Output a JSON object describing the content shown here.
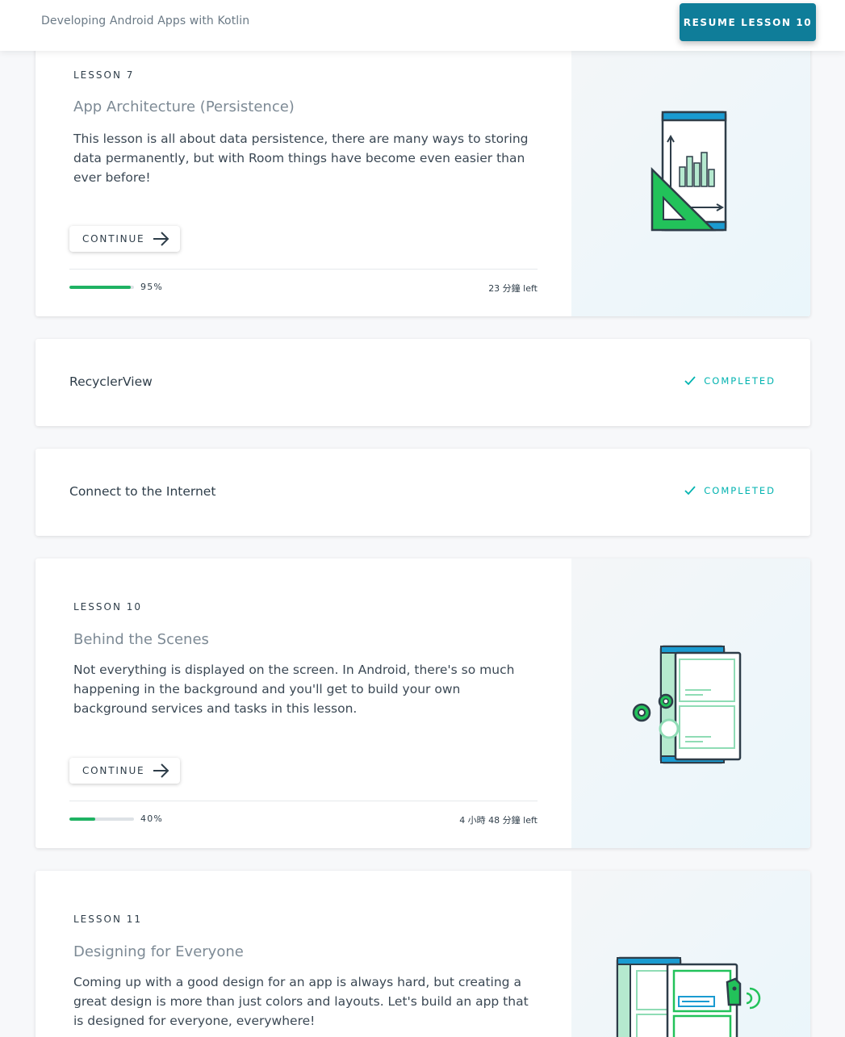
{
  "header": {
    "course_title": "Developing Android Apps with Kotlin",
    "resume_label": "RESUME LESSON 10",
    "accent_color": "#0f7d99"
  },
  "lessons": [
    {
      "label": "LESSON 7",
      "title": "App Architecture (Persistence)",
      "description": "This lesson is all about data persistence, there are many ways to storing data permanently, but with Room things have become even easier than ever before!",
      "continue_label": "CONTINUE",
      "progress_percent": 95,
      "progress_text": "95%",
      "time_left": "23 分鐘 left",
      "illustration": "phone-chart-icon"
    },
    {
      "title": "RecyclerView",
      "status": "COMPLETED",
      "status_icon": "check-icon"
    },
    {
      "title": "Connect to the Internet",
      "status": "COMPLETED",
      "status_icon": "check-icon"
    },
    {
      "label": "LESSON 10",
      "title": "Behind the Scenes",
      "description": "Not everything is displayed on the screen. In Android, there's so much happening in the background and you'll get to build your own background services and tasks in this lesson.",
      "continue_label": "CONTINUE",
      "progress_percent": 40,
      "progress_text": "40%",
      "time_left": "4 小時 48 分鐘 left",
      "illustration": "tablet-gears-icon"
    },
    {
      "label": "LESSON 11",
      "title": "Designing for Everyone",
      "description": "Coming up with a good design for an app is always hard, but creating a great design is more than just colors and layouts. Let's build an app that is designed for everyone, everywhere!",
      "illustration": "accessible-design-icon"
    }
  ],
  "colors": {
    "progress": "#1fb263",
    "completed": "#02b3b0"
  }
}
